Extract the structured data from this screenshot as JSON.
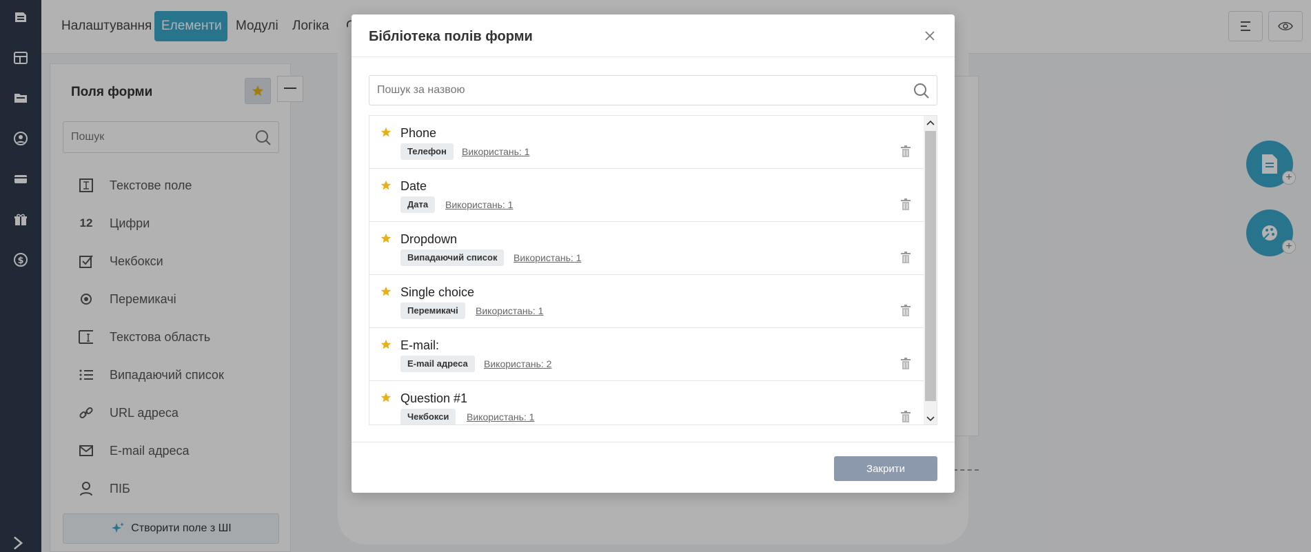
{
  "topbar": {
    "tabs": [
      {
        "label": "Налаштування"
      },
      {
        "label": "Елементи",
        "active": true
      },
      {
        "label": "Модулі"
      },
      {
        "label": "Логіка"
      },
      {
        "label": "С"
      }
    ]
  },
  "rail": {
    "icons": [
      "forms-icon",
      "layout-icon",
      "folder-icon",
      "user-icon",
      "card-icon",
      "gift-icon",
      "dollar-icon"
    ]
  },
  "sidebar": {
    "title": "Поля форми",
    "search_placeholder": "Пошук",
    "items": [
      {
        "label": "Текстове поле",
        "icon": "text-field-icon"
      },
      {
        "label": "Цифри",
        "icon": "numbers-icon",
        "glyph": "12"
      },
      {
        "label": "Чекбокси",
        "icon": "checkbox-icon"
      },
      {
        "label": "Перемикачі",
        "icon": "radio-icon"
      },
      {
        "label": "Текстова область",
        "icon": "textarea-icon"
      },
      {
        "label": "Випадаючий список",
        "icon": "list-icon"
      },
      {
        "label": "URL адреса",
        "icon": "link-icon"
      },
      {
        "label": "E-mail адреса",
        "icon": "mail-icon"
      },
      {
        "label": "ПІБ",
        "icon": "person-icon"
      }
    ],
    "ai_button_label": "Створити поле з ШІ"
  },
  "modal": {
    "title": "Бібліотека полів форми",
    "search_placeholder": "Пошук за назвою",
    "rows": [
      {
        "name": "Phone",
        "tag": "Телефон",
        "usage": "Використань: 1"
      },
      {
        "name": "Date",
        "tag": "Дата",
        "usage": "Використань: 1"
      },
      {
        "name": "Dropdown",
        "tag": "Випадаючий список",
        "usage": "Використань: 1"
      },
      {
        "name": "Single choice",
        "tag": "Перемикачі",
        "usage": "Використань: 1"
      },
      {
        "name": "E-mail:",
        "tag": "E-mail адреса",
        "usage": "Використань: 2"
      },
      {
        "name": "Question #1",
        "tag": "Чекбокси",
        "usage": "Використань: 1"
      }
    ],
    "close_label": "Закрити"
  },
  "colors": {
    "accent": "#3aa6c9",
    "rail": "#2f3b4c",
    "star": "#e5b319",
    "close_button": "#8c98ab"
  }
}
